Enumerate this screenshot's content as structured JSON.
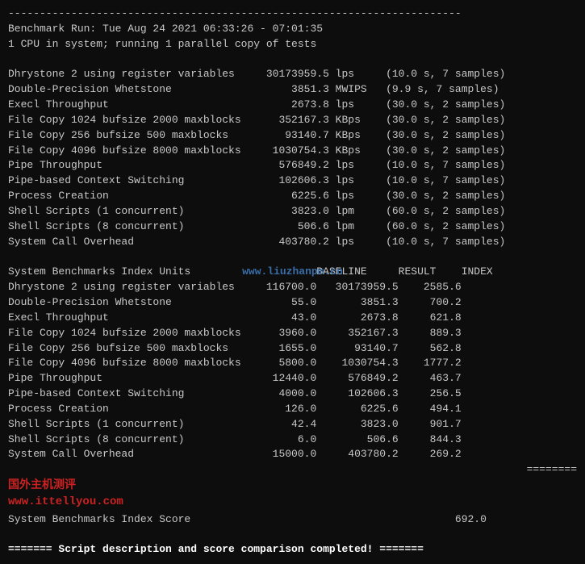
{
  "terminal": {
    "separator_top": "------------------------------------------------------------------------",
    "benchmark_run": "Benchmark Run: Tue Aug 24 2021 06:33:26 - 07:01:35",
    "cpu_info": "1 CPU in system; running 1 parallel copy of tests",
    "tests_raw": [
      {
        "name": "Dhrystone 2 using register variables",
        "value": "30173959.5",
        "unit": "lps",
        "info": "(10.0 s, 7 samples)"
      },
      {
        "name": "Double-Precision Whetstone",
        "value": "3851.3",
        "unit": "MWIPS",
        "info": "(9.9 s, 7 samples)"
      },
      {
        "name": "Execl Throughput",
        "value": "2673.8",
        "unit": "lps",
        "info": "(30.0 s, 2 samples)"
      },
      {
        "name": "File Copy 1024 bufsize 2000 maxblocks",
        "value": "352167.3",
        "unit": "KBps",
        "info": "(30.0 s, 2 samples)"
      },
      {
        "name": "File Copy 256 bufsize 500 maxblocks",
        "value": "93140.7",
        "unit": "KBps",
        "info": "(30.0 s, 2 samples)"
      },
      {
        "name": "File Copy 4096 bufsize 8000 maxblocks",
        "value": "1030754.3",
        "unit": "KBps",
        "info": "(30.0 s, 2 samples)"
      },
      {
        "name": "Pipe Throughput",
        "value": "576849.2",
        "unit": "lps",
        "info": "(10.0 s, 7 samples)"
      },
      {
        "name": "Pipe-based Context Switching",
        "value": "102606.3",
        "unit": "lps",
        "info": "(10.0 s, 7 samples)"
      },
      {
        "name": "Process Creation",
        "value": "6225.6",
        "unit": "lps",
        "info": "(30.0 s, 2 samples)"
      },
      {
        "name": "Shell Scripts (1 concurrent)",
        "value": "3823.0",
        "unit": "lpm",
        "info": "(60.0 s, 2 samples)"
      },
      {
        "name": "Shell Scripts (8 concurrent)",
        "value": "506.6",
        "unit": "lpm",
        "info": "(60.0 s, 2 samples)"
      },
      {
        "name": "System Call Overhead",
        "value": "403780.2",
        "unit": "lps",
        "info": "(10.0 s, 7 samples)"
      }
    ],
    "index_header": {
      "col1": "System Benchmarks Index Units",
      "col2": "BASELINE",
      "col3": "RESULT",
      "col4": "INDEX"
    },
    "tests_index": [
      {
        "name": "Dhrystone 2 using register variables",
        "baseline": "116700.0",
        "result": "30173959.5",
        "index": "2585.6"
      },
      {
        "name": "Double-Precision Whetstone",
        "baseline": "55.0",
        "result": "3851.3",
        "index": "700.2"
      },
      {
        "name": "Execl Throughput",
        "baseline": "43.0",
        "result": "2673.8",
        "index": "621.8"
      },
      {
        "name": "File Copy 1024 bufsize 2000 maxblocks",
        "baseline": "3960.0",
        "result": "352167.3",
        "index": "889.3"
      },
      {
        "name": "File Copy 256 bufsize 500 maxblocks",
        "baseline": "1655.0",
        "result": "93140.7",
        "index": "562.8"
      },
      {
        "name": "File Copy 4096 bufsize 8000 maxblocks",
        "baseline": "5800.0",
        "result": "1030754.3",
        "index": "1777.2"
      },
      {
        "name": "Pipe Throughput",
        "baseline": "12440.0",
        "result": "576849.2",
        "index": "463.7"
      },
      {
        "name": "Pipe-based Context Switching",
        "baseline": "4000.0",
        "result": "102606.3",
        "index": "256.5"
      },
      {
        "name": "Process Creation",
        "baseline": "126.0",
        "result": "6225.6",
        "index": "494.1"
      },
      {
        "name": "Shell Scripts (1 concurrent)",
        "baseline": "42.4",
        "result": "3823.0",
        "index": "901.7"
      },
      {
        "name": "Shell Scripts (8 concurrent)",
        "baseline": "6.0",
        "result": "506.6",
        "index": "844.3"
      },
      {
        "name": "System Call Overhead",
        "baseline": "15000.0",
        "result": "403780.2",
        "index": "269.2"
      }
    ],
    "equal_signs": "========",
    "score_label": "System Benchmarks Index Score",
    "score_value": "692.0",
    "watermark1": "www.liuzhanpm.cn",
    "watermark2": "国外主机测评",
    "watermark3": "www.ittellyou.com",
    "footer": "======= Script description and score comparison completed! ======="
  }
}
